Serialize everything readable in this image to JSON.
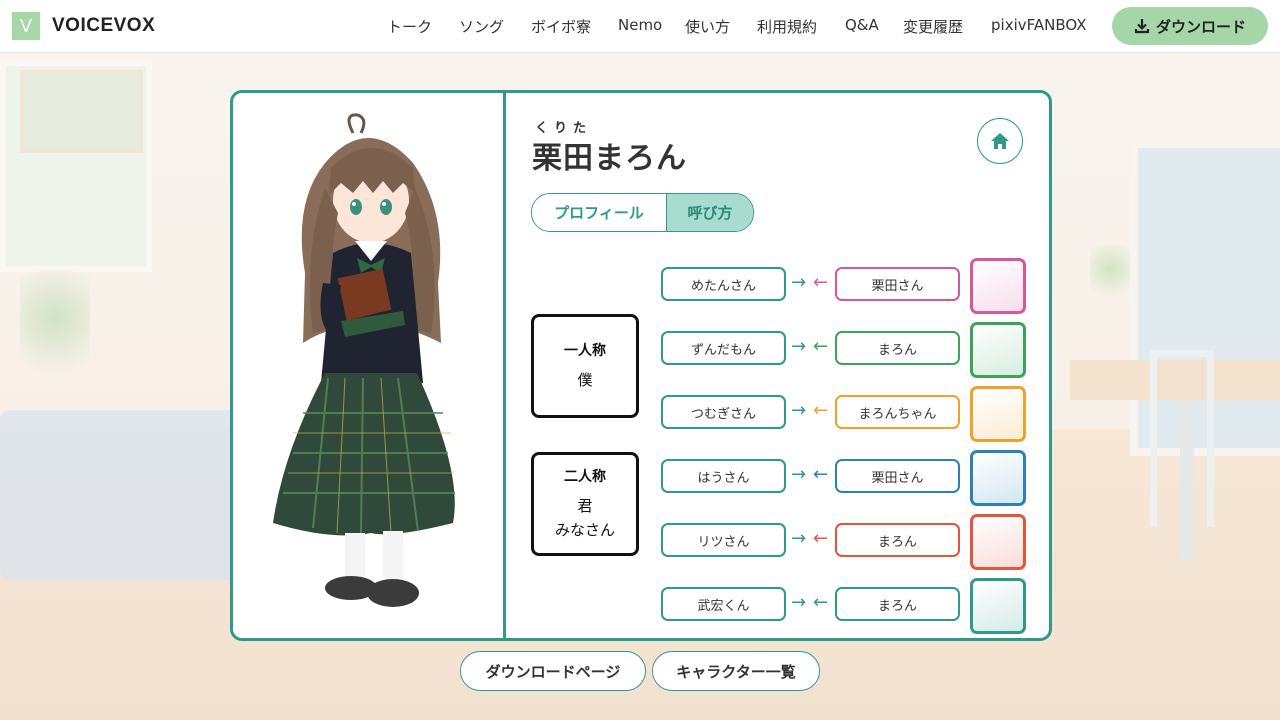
{
  "header": {
    "logo_letter": "V",
    "logo_text": "VOICEVOX",
    "nav": [
      "トーク",
      "ソング",
      "ボイボ寮",
      "Nemo",
      "使い方",
      "利用規約",
      "Q&A",
      "変更履歴",
      "pixivFANBOX"
    ],
    "download_label": "ダウンロード",
    "download_icon": "download-icon"
  },
  "character": {
    "ruby": "くりた",
    "name": "栗田まろん",
    "home_icon": "home-icon"
  },
  "tabs": {
    "profile": "プロフィール",
    "yobikata": "呼び方"
  },
  "first_person": {
    "title": "一人称",
    "values": [
      "僕"
    ]
  },
  "second_person": {
    "title": "二人称",
    "values": [
      "君",
      "みなさん"
    ]
  },
  "relations": [
    {
      "to": "めたんさん",
      "from": "栗田さん",
      "color": "#d6589b"
    },
    {
      "to": "ずんだもん",
      "from": "まろん",
      "color": "#3aa55a"
    },
    {
      "to": "つむぎさん",
      "from": "まろんちゃん",
      "color": "#f0a12a"
    },
    {
      "to": "はうさん",
      "from": "栗田さん",
      "color": "#2a82b6"
    },
    {
      "to": "リツさん",
      "from": "まろん",
      "color": "#e4553e"
    },
    {
      "to": "武宏くん",
      "from": "まろん",
      "color": "#2e9b8a"
    }
  ],
  "colors": {
    "accent": "#2e9b8a",
    "header_button": "#a5d6a7"
  },
  "bottom": {
    "download_page": "ダウンロードページ",
    "character_list": "キャラクター一覧"
  }
}
